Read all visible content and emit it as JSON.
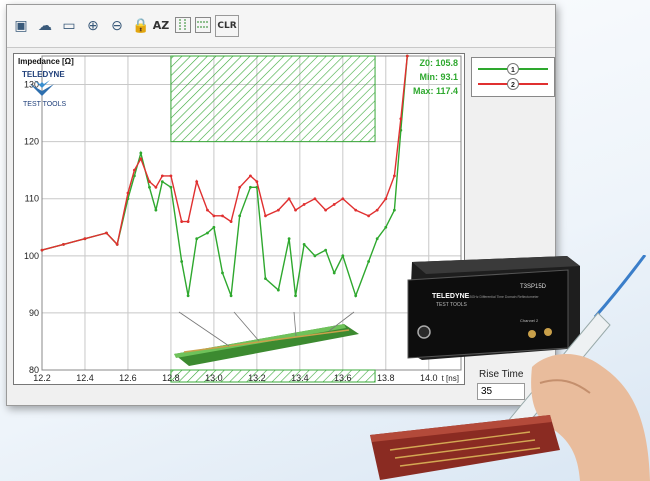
{
  "toolbar": {
    "items": [
      {
        "name": "open-icon",
        "glyph": "▣"
      },
      {
        "name": "cloud-icon",
        "glyph": "☁"
      },
      {
        "name": "monitor-icon",
        "glyph": "▭"
      },
      {
        "name": "zoom-in-icon",
        "glyph": "⊕"
      },
      {
        "name": "zoom-out-icon",
        "glyph": "⊖"
      },
      {
        "name": "lock-icon",
        "glyph": "🔒"
      }
    ],
    "az_label": "AZ",
    "clr_label": "CLR"
  },
  "plot": {
    "y_title": "Impedance [Ω]",
    "logo_line1": "TELEDYNE",
    "logo_line2": "TEST TOOLS",
    "stats": {
      "z0": "Z0: 105.8",
      "min": "Min: 93.1",
      "max": "Max: 117.4"
    },
    "x_unit": "t [ns]",
    "colors": {
      "trace1": "#2ea82e",
      "trace2": "#e03030",
      "hatch": "#3aa83a"
    }
  },
  "chart_data": {
    "type": "line",
    "xlim": [
      12.2,
      14.15
    ],
    "ylim": [
      80,
      135
    ],
    "x_ticks": [
      "12.2",
      "12.4",
      "12.6",
      "12.8",
      "13.0",
      "13.2",
      "13.4",
      "13.6",
      "13.8",
      "14.0"
    ],
    "y_ticks": [
      "130",
      "120",
      "110",
      "100",
      "90",
      "80"
    ],
    "series": [
      {
        "name": "1",
        "color": "#2ea82e",
        "x": [
          12.2,
          12.3,
          12.4,
          12.5,
          12.55,
          12.6,
          12.63,
          12.66,
          12.7,
          12.73,
          12.76,
          12.8,
          12.85,
          12.88,
          12.92,
          12.97,
          13.0,
          13.04,
          13.08,
          13.12,
          13.17,
          13.2,
          13.24,
          13.3,
          13.35,
          13.38,
          13.42,
          13.47,
          13.52,
          13.56,
          13.6,
          13.66,
          13.72,
          13.76,
          13.8,
          13.84,
          13.87,
          13.9
        ],
        "y": [
          101,
          102,
          103,
          104,
          102,
          110,
          114,
          118,
          112,
          108,
          113,
          112,
          99,
          93,
          103,
          104,
          105,
          97,
          93,
          107,
          112,
          112,
          96,
          94,
          103,
          93,
          102,
          100,
          101,
          97,
          100,
          93,
          99,
          103,
          105,
          108,
          122,
          138
        ]
      },
      {
        "name": "2",
        "color": "#e03030",
        "x": [
          12.2,
          12.3,
          12.4,
          12.5,
          12.55,
          12.6,
          12.63,
          12.66,
          12.7,
          12.73,
          12.76,
          12.8,
          12.85,
          12.88,
          12.92,
          12.97,
          13.0,
          13.04,
          13.08,
          13.12,
          13.17,
          13.2,
          13.24,
          13.3,
          13.35,
          13.38,
          13.42,
          13.47,
          13.52,
          13.56,
          13.6,
          13.66,
          13.72,
          13.76,
          13.8,
          13.84,
          13.87,
          13.9
        ],
        "y": [
          101,
          102,
          103,
          104,
          102,
          111,
          115,
          117,
          113,
          112,
          114,
          114,
          106,
          106,
          113,
          108,
          107,
          107,
          106,
          112,
          114,
          113,
          107,
          108,
          110,
          108,
          109,
          110,
          108,
          109,
          110,
          108,
          107,
          108,
          110,
          114,
          124,
          138
        ]
      }
    ],
    "limit_bands": [
      {
        "x0": 12.8,
        "x1": 13.75,
        "y0": 120,
        "y1": 135
      },
      {
        "x0": 12.8,
        "x1": 13.75,
        "y0": 80,
        "y1": 79.0
      }
    ]
  },
  "legend": {
    "items": [
      {
        "label": "1",
        "color": "#2ea82e"
      },
      {
        "label": "2",
        "color": "#e03030"
      }
    ]
  },
  "rise_time": {
    "label": "Rise Time",
    "value": "35"
  },
  "device": {
    "brand": "TELEDYNE",
    "brand2": "TEST TOOLS",
    "model": "T3SP15D",
    "desc": "15GHz Differential Time Domain Reflectometer",
    "ch_label": "Channel 2"
  }
}
